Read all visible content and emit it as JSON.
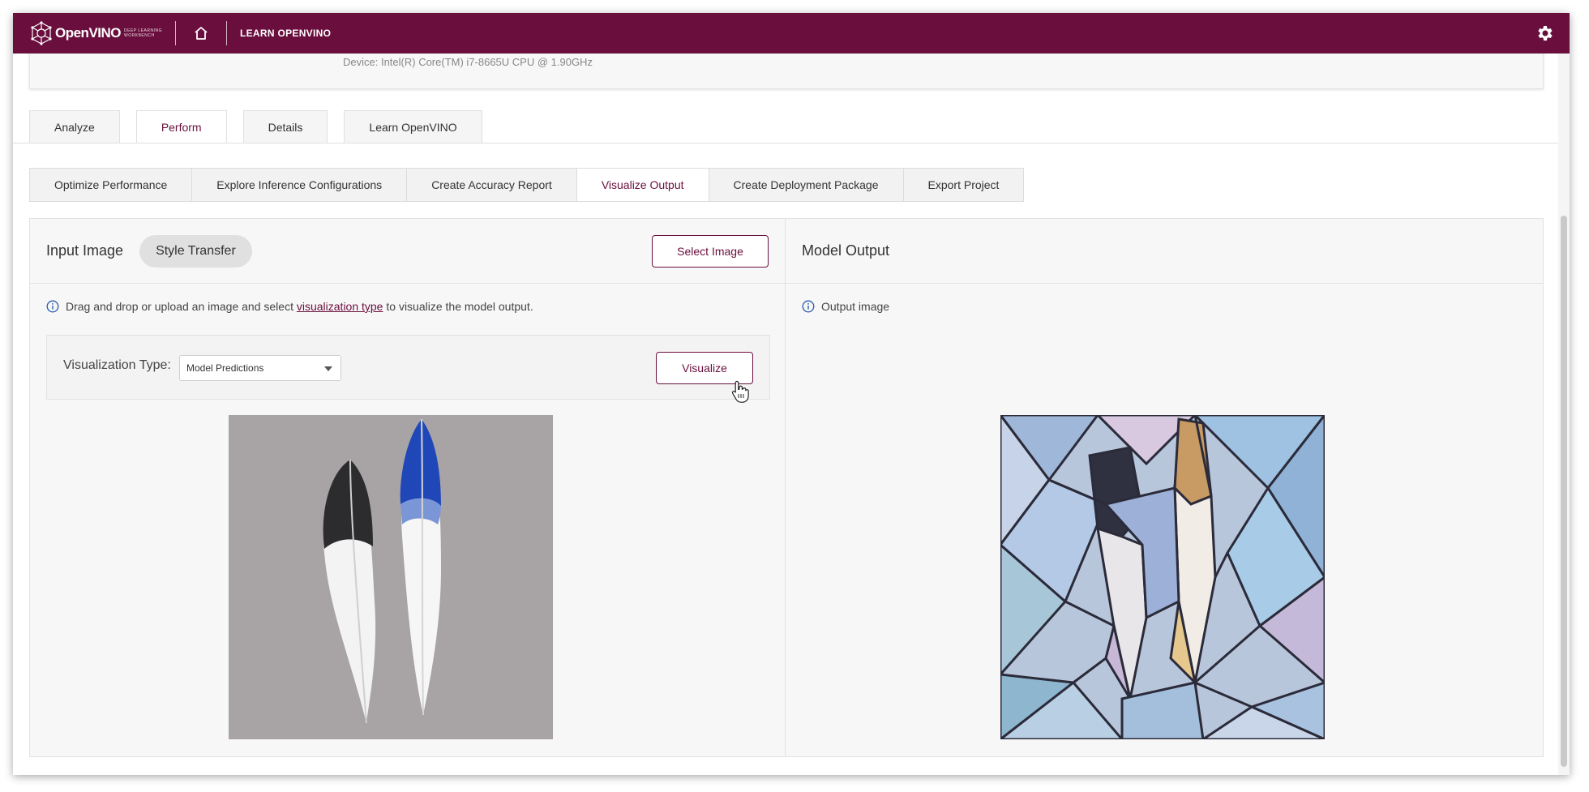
{
  "topbar": {
    "logo_text": "OpenVINO",
    "logo_sub_1": "DEEP LEARNING",
    "logo_sub_2": "WORKBENCH",
    "nav_learn": "LEARN OPENVINO",
    "icons": [
      "openvino-logo",
      "home-icon",
      "gear-icon"
    ],
    "brand_color": "#6a0f3d"
  },
  "info_panel": {
    "text": "Device: Intel(R) Core(TM) i7-8665U CPU @ 1.90GHz"
  },
  "main_tabs": [
    {
      "label": "Analyze",
      "active": false
    },
    {
      "label": "Perform",
      "active": true
    },
    {
      "label": "Details",
      "active": false
    },
    {
      "label": "Learn OpenVINO",
      "active": false
    }
  ],
  "sub_tabs": [
    {
      "label": "Optimize Performance",
      "active": false
    },
    {
      "label": "Explore Inference Configurations",
      "active": false
    },
    {
      "label": "Create Accuracy Report",
      "active": false
    },
    {
      "label": "Visualize Output",
      "active": true
    },
    {
      "label": "Create Deployment Package",
      "active": false
    },
    {
      "label": "Export Project",
      "active": false
    }
  ],
  "input_panel": {
    "title": "Input Image",
    "chip": "Style Transfer",
    "select_button": "Select Image",
    "hint_before": "Drag and drop or upload an image and select ",
    "hint_link": "visualization type",
    "hint_after": " to visualize the model output.",
    "viz_label": "Visualization Type:",
    "viz_selected": "Model Predictions",
    "visualize_button": "Visualize"
  },
  "output_panel": {
    "title": "Model Output",
    "hint": "Output image"
  }
}
